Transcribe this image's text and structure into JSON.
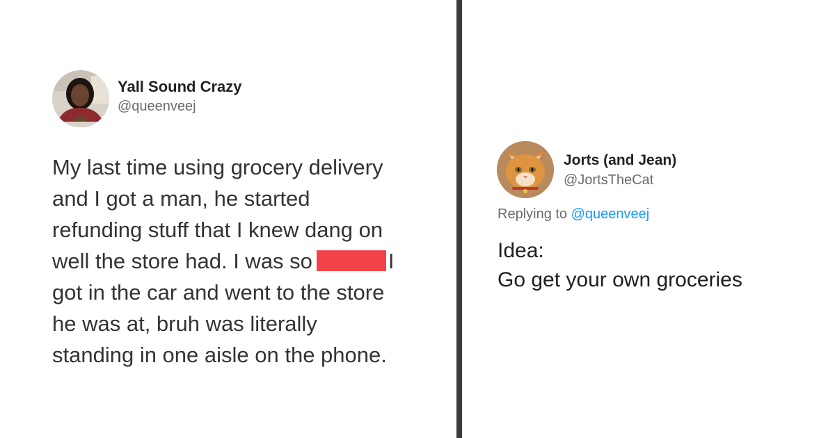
{
  "left_tweet": {
    "display_name": "Yall Sound Crazy",
    "handle": "@queenveej",
    "avatar_icon": "profile-photo-woman",
    "body": {
      "line1": "My last time using grocery delivery",
      "line2": "and I got a man, he started",
      "line3": "refunding stuff that I knew dang on",
      "line4_before": "well the store had. I was so",
      "line4_after": "I",
      "line5": "got in the car and went to the store",
      "line6": "he was at, bruh was literally",
      "line7": "standing in one aisle on the phone."
    },
    "redaction_color": "#f2434a"
  },
  "right_tweet": {
    "display_name": "Jorts (and Jean)",
    "handle": "@JortsTheCat",
    "avatar_icon": "profile-photo-orange-cat",
    "reply_prefix": "Replying to",
    "reply_mention": "@queenveej",
    "body": {
      "line1": "Idea:",
      "line2": "Go get your own groceries"
    },
    "mention_color": "#1d9bf0"
  },
  "divider_color": "#3b3b3b"
}
